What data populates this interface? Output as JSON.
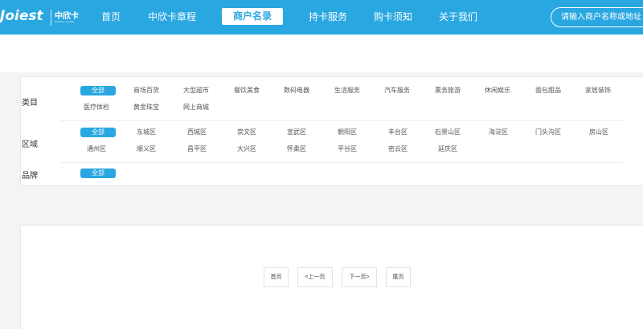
{
  "header": {
    "logo_word": "Joiest",
    "logo_cn": "中欣卡",
    "logo_en": "JOIEST CARD",
    "nav": [
      {
        "label": "首页"
      },
      {
        "label": "中欣卡章程"
      },
      {
        "label": "商户名录"
      },
      {
        "label": "持卡服务"
      },
      {
        "label": "购卡须知"
      },
      {
        "label": "关于我们"
      }
    ],
    "search_placeholder": "请输入商户名称或地址"
  },
  "filters": {
    "category": {
      "label": "类目",
      "options": [
        "全部",
        "商场百货",
        "大型超市",
        "餐饮美食",
        "数码电器",
        "生活服务",
        "汽车服务",
        "票务旅游",
        "休闲娱乐",
        "面包甜品",
        "家居装饰",
        "医疗体检",
        "黄金珠宝",
        "网上商城"
      ]
    },
    "district": {
      "label": "区域",
      "options": [
        "全部",
        "东城区",
        "西城区",
        "崇文区",
        "宣武区",
        "朝阳区",
        "丰台区",
        "石景山区",
        "海淀区",
        "门头沟区",
        "房山区",
        "通州区",
        "顺义区",
        "昌平区",
        "大兴区",
        "怀柔区",
        "平谷区",
        "密云区",
        "延庆区"
      ]
    },
    "brand": {
      "label": "品牌",
      "options": [
        "全部"
      ]
    }
  },
  "pagination": {
    "first": "首页",
    "prev": "<上一页",
    "next": "下一页>",
    "last": "尾页"
  },
  "colors": {
    "accent": "#29a7e1"
  }
}
